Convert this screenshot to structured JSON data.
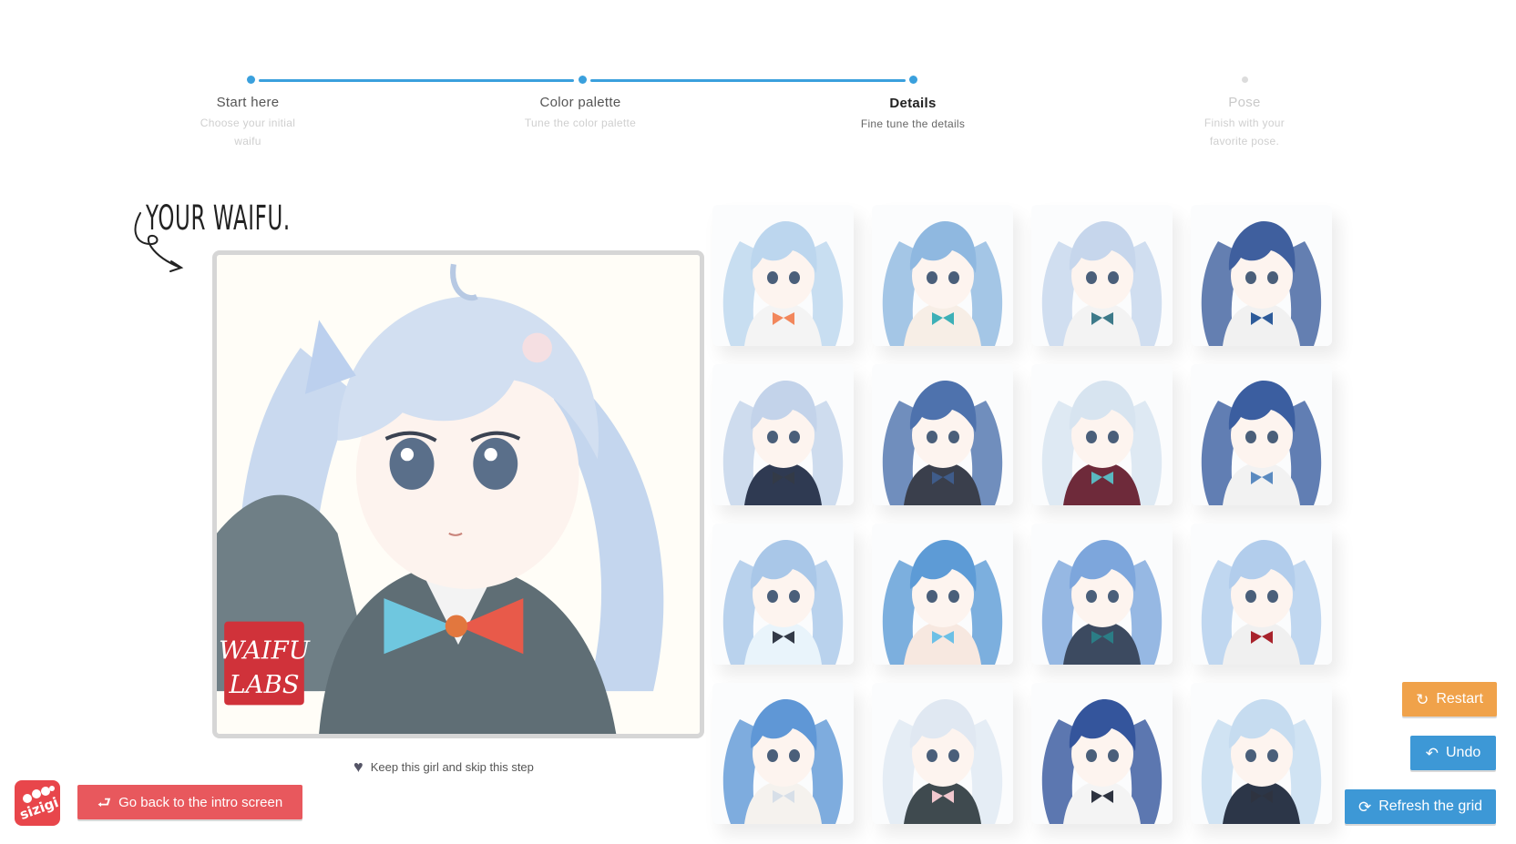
{
  "stepper": {
    "steps": [
      {
        "title": "Start here",
        "desc": "Choose your initial waifu",
        "state": "done"
      },
      {
        "title": "Color palette",
        "desc": "Tune the color palette",
        "state": "done"
      },
      {
        "title": "Details",
        "desc": "Fine tune the details",
        "state": "active"
      },
      {
        "title": "Pose",
        "desc": "Finish with your favorite pose.",
        "state": "pending"
      }
    ]
  },
  "heading": "YOUR WAIFU.",
  "portrait": {
    "watermark_line1": "WAIFU",
    "watermark_line2": "LABS"
  },
  "keep_link": "Keep this girl and skip this step",
  "grid": {
    "tiles": [
      {
        "hair": "#bcd6ee",
        "bow": "#f2875c",
        "outfit": "#f4f4f4"
      },
      {
        "hair": "#8fb8e0",
        "bow": "#3db0b7",
        "outfit": "#f7eee6"
      },
      {
        "hair": "#c6d6ec",
        "bow": "#3d7a8a",
        "outfit": "#f3f3f3"
      },
      {
        "hair": "#3f5f9e",
        "bow": "#2d5b9a",
        "outfit": "#f1f1f1"
      },
      {
        "hair": "#c3d3ea",
        "bow": "#333a47",
        "outfit": "#2f3a52"
      },
      {
        "hair": "#4e72ad",
        "bow": "#3f5c8a",
        "outfit": "#3a3f4c"
      },
      {
        "hair": "#d7e4f0",
        "bow": "#5ab8c0",
        "outfit": "#6e2a3a"
      },
      {
        "hair": "#3b5ea0",
        "bow": "#5a8ac0",
        "outfit": "#f2f2f2"
      },
      {
        "hair": "#a9c7e8",
        "bow": "#333a47",
        "outfit": "#e9f4fb"
      },
      {
        "hair": "#5d9bd6",
        "bow": "#6cc0e6",
        "outfit": "#f7e8e0"
      },
      {
        "hair": "#7da6dc",
        "bow": "#2b7d86",
        "outfit": "#3c4a60"
      },
      {
        "hair": "#b2cdec",
        "bow": "#a8232c",
        "outfit": "#f0f0f0"
      },
      {
        "hair": "#5f97d6",
        "bow": "#d7dfe8",
        "outfit": "#f5f2ee"
      },
      {
        "hair": "#e0e8f2",
        "bow": "#f2c8cf",
        "outfit": "#3f4a4f"
      },
      {
        "hair": "#34559c",
        "bow": "#2e3340",
        "outfit": "#f4f4f4"
      },
      {
        "hair": "#c6dcf0",
        "bow": "#2e3340",
        "outfit": "#2c3648"
      }
    ]
  },
  "buttons": {
    "restart": "Restart",
    "undo": "Undo",
    "refresh": "Refresh the grid",
    "back": "Go back to the intro screen"
  },
  "logo_text": "sizigi",
  "colors": {
    "accent": "#3aa0dd",
    "restart": "#f0a24a",
    "primary": "#3d98d6",
    "danger": "#e8585d",
    "logo": "#e8464b"
  }
}
